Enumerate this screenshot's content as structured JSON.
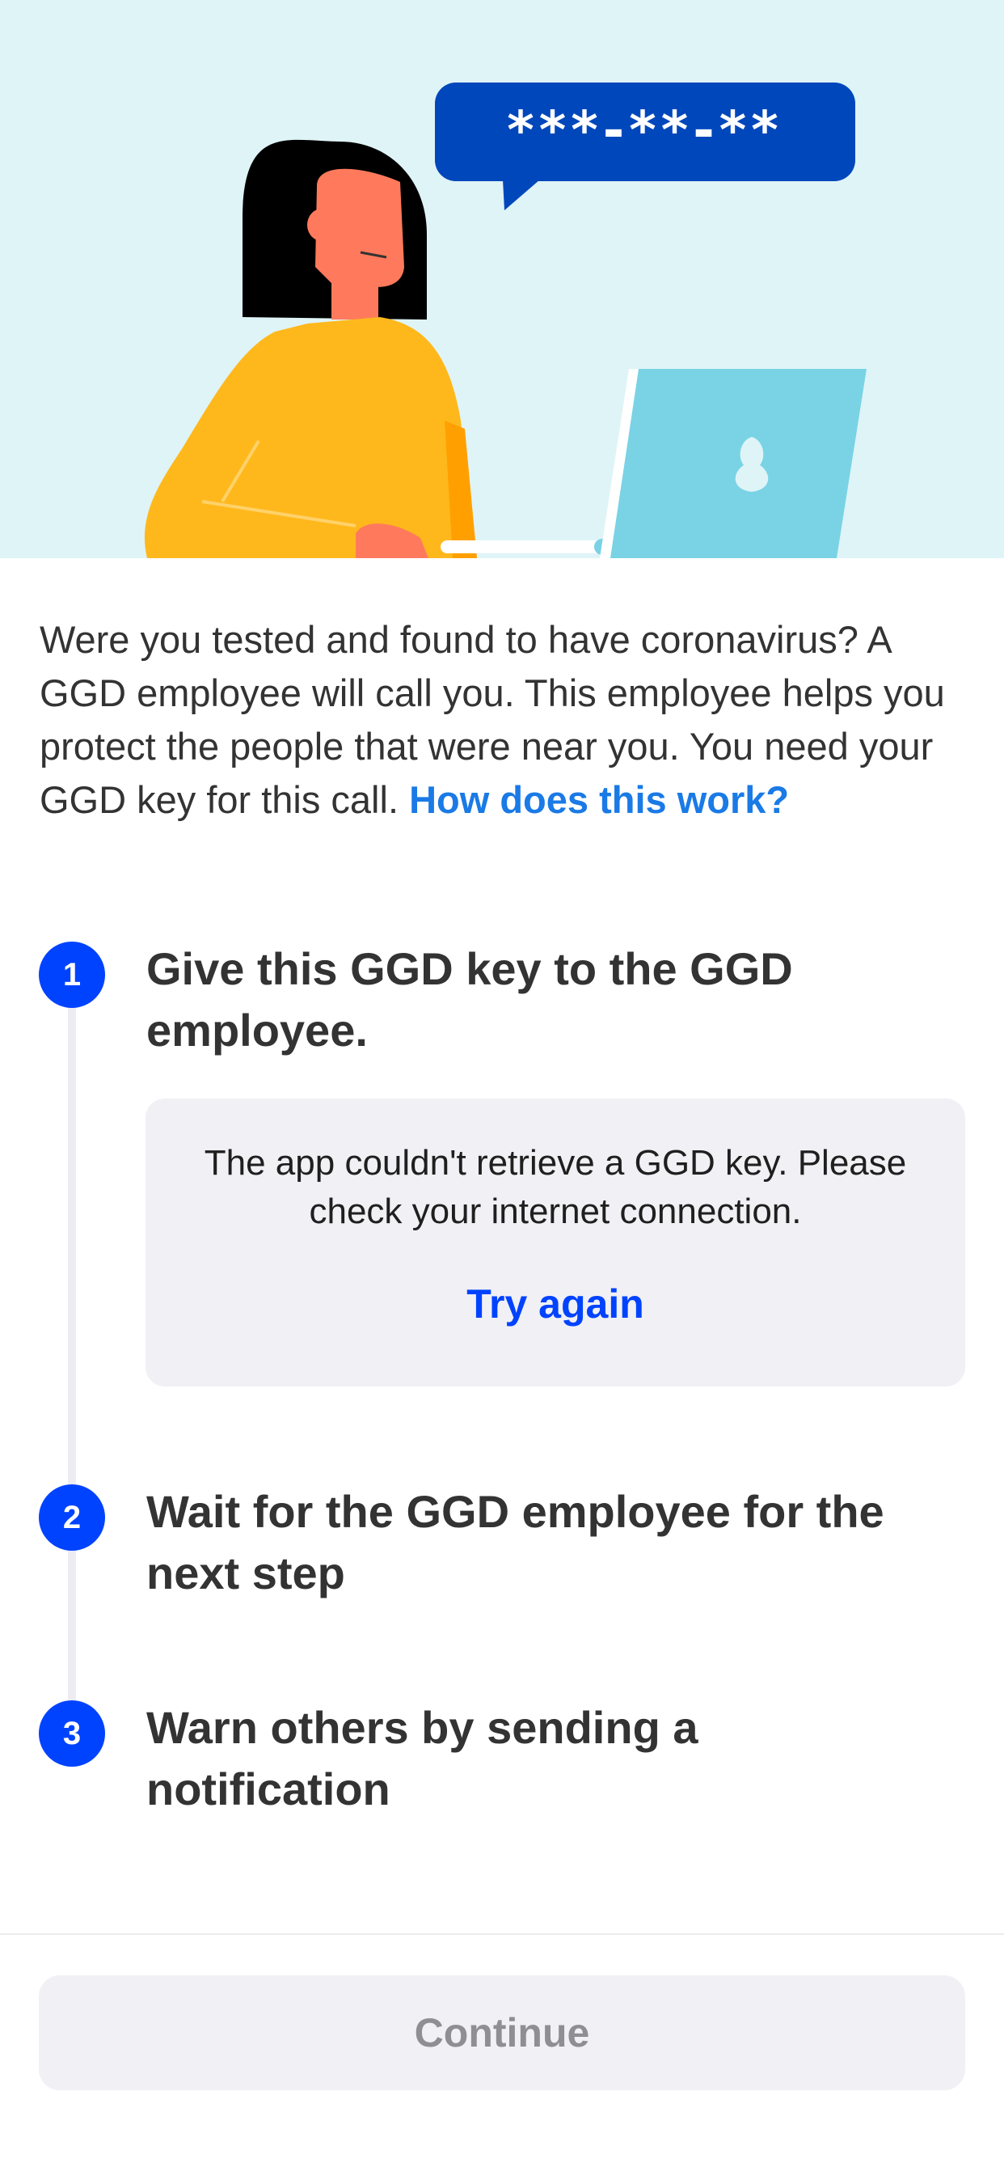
{
  "illustration": {
    "key_placeholder": "***-**-**",
    "bubble_color": "#0047bb",
    "laptop_color": "#79d3e5",
    "sweater_color": "#ffb81c"
  },
  "intro": {
    "text": "Were you tested and found to have coronavirus? A GGD employee will call you. This employee helps you protect the people that were near you. You need your GGD key for this call. ",
    "link": "How does this work?"
  },
  "steps": [
    {
      "number": "1",
      "title": "Give this GGD key to the GGD employee."
    },
    {
      "number": "2",
      "title": "Wait for the GGD employee for the next step"
    },
    {
      "number": "3",
      "title": "Warn others by sending a notification"
    }
  ],
  "error": {
    "message": "The app couldn't retrieve a GGD key. Please check your internet connection.",
    "retry_label": "Try again"
  },
  "footer": {
    "continue_label": "Continue"
  },
  "colors": {
    "accent": "#0043ff",
    "link": "#1a7ae6",
    "disabled_text": "#8e8e93",
    "card_bg": "#f0f0f5"
  }
}
